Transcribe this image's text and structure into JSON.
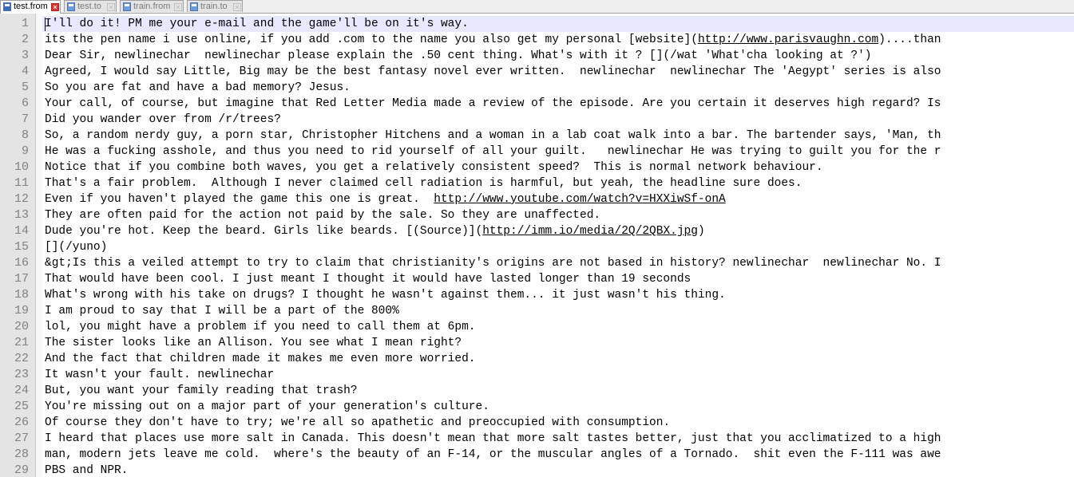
{
  "tabs": [
    {
      "label": "test.from",
      "active": true
    },
    {
      "label": "test.to",
      "active": false
    },
    {
      "label": "train.from",
      "active": false
    },
    {
      "label": "train.to",
      "active": false
    }
  ],
  "lines": [
    {
      "num": "1",
      "parts": [
        {
          "t": "I'll do it! PM me your e-mail and the game'll be on it's way."
        }
      ]
    },
    {
      "num": "2",
      "parts": [
        {
          "t": "its the pen name i use online, if you add .com to the name you also get my personal [website]("
        },
        {
          "t": "http://www.parisvaughn.com",
          "link": true
        },
        {
          "t": ")....than"
        }
      ]
    },
    {
      "num": "3",
      "parts": [
        {
          "t": "Dear Sir, newlinechar  newlinechar please explain the .50 cent thing. What's with it ? [](/wat 'What'cha looking at ?')"
        }
      ]
    },
    {
      "num": "4",
      "parts": [
        {
          "t": "Agreed, I would say Little, Big may be the best fantasy novel ever written.  newlinechar  newlinechar The 'Aegypt' series is also"
        }
      ]
    },
    {
      "num": "5",
      "parts": [
        {
          "t": "So you are fat and have a bad memory? Jesus."
        }
      ]
    },
    {
      "num": "6",
      "parts": [
        {
          "t": "Your call, of course, but imagine that Red Letter Media made a review of the episode. Are you certain it deserves high regard? Is"
        }
      ]
    },
    {
      "num": "7",
      "parts": [
        {
          "t": "Did you wander over from /r/trees?"
        }
      ]
    },
    {
      "num": "8",
      "parts": [
        {
          "t": "So, a random nerdy guy, a porn star, Christopher Hitchens and a woman in a lab coat walk into a bar. The bartender says, 'Man, th"
        }
      ]
    },
    {
      "num": "9",
      "parts": [
        {
          "t": "He was a fucking asshole, and thus you need to rid yourself of all your guilt.   newlinechar He was trying to guilt you for the r"
        }
      ]
    },
    {
      "num": "10",
      "parts": [
        {
          "t": "Notice that if you combine both waves, you get a relatively consistent speed?  This is normal network behaviour."
        }
      ]
    },
    {
      "num": "11",
      "parts": [
        {
          "t": "That's a fair problem.  Although I never claimed cell radiation is harmful, but yeah, the headline sure does."
        }
      ]
    },
    {
      "num": "12",
      "parts": [
        {
          "t": "Even if you haven't played the game this one is great.  "
        },
        {
          "t": "http://www.youtube.com/watch?v=HXXiwSf-onA",
          "link": true
        }
      ]
    },
    {
      "num": "13",
      "parts": [
        {
          "t": "They are often paid for the action not paid by the sale. So they are unaffected."
        }
      ]
    },
    {
      "num": "14",
      "parts": [
        {
          "t": "Dude you're hot. Keep the beard. Girls like beards. [(Source)]("
        },
        {
          "t": "http://imm.io/media/2Q/2QBX.jpg",
          "link": true
        },
        {
          "t": ")"
        }
      ]
    },
    {
      "num": "15",
      "parts": [
        {
          "t": "[](/yuno)"
        }
      ]
    },
    {
      "num": "16",
      "parts": [
        {
          "t": "&gt;Is this a veiled attempt to try to claim that christianity's origins are not based in history? newlinechar  newlinechar No. I"
        }
      ]
    },
    {
      "num": "17",
      "parts": [
        {
          "t": "That would have been cool. I just meant I thought it would have lasted longer than 19 seconds"
        }
      ]
    },
    {
      "num": "18",
      "parts": [
        {
          "t": "What's wrong with his take on drugs? I thought he wasn't against them... it just wasn't his thing."
        }
      ]
    },
    {
      "num": "19",
      "parts": [
        {
          "t": "I am proud to say that I will be a part of the 800%"
        }
      ]
    },
    {
      "num": "20",
      "parts": [
        {
          "t": "lol, you might have a problem if you need to call them at 6pm."
        }
      ]
    },
    {
      "num": "21",
      "parts": [
        {
          "t": "The sister looks like an Allison. You see what I mean right?"
        }
      ]
    },
    {
      "num": "22",
      "parts": [
        {
          "t": "And the fact that children made it makes me even more worried."
        }
      ]
    },
    {
      "num": "23",
      "parts": [
        {
          "t": "It wasn't your fault. newlinechar"
        }
      ]
    },
    {
      "num": "24",
      "parts": [
        {
          "t": "But, you want your family reading that trash?"
        }
      ]
    },
    {
      "num": "25",
      "parts": [
        {
          "t": "You're missing out on a major part of your generation's culture."
        }
      ]
    },
    {
      "num": "26",
      "parts": [
        {
          "t": "Of course they don't have to try; we're all so apathetic and preoccupied with consumption."
        }
      ]
    },
    {
      "num": "27",
      "parts": [
        {
          "t": "I heard that places use more salt in Canada. This doesn't mean that more salt tastes better, just that you acclimatized to a high"
        }
      ]
    },
    {
      "num": "28",
      "parts": [
        {
          "t": "man, modern jets leave me cold.  where's the beauty of an F-14, or the muscular angles of a Tornado.  shit even the F-111 was awe"
        }
      ]
    },
    {
      "num": "29",
      "parts": [
        {
          "t": "PBS and NPR."
        }
      ]
    }
  ],
  "colors": {
    "current_line": "#e8e8ff",
    "gutter": "#e4e4e4",
    "line_number": "#808080"
  }
}
